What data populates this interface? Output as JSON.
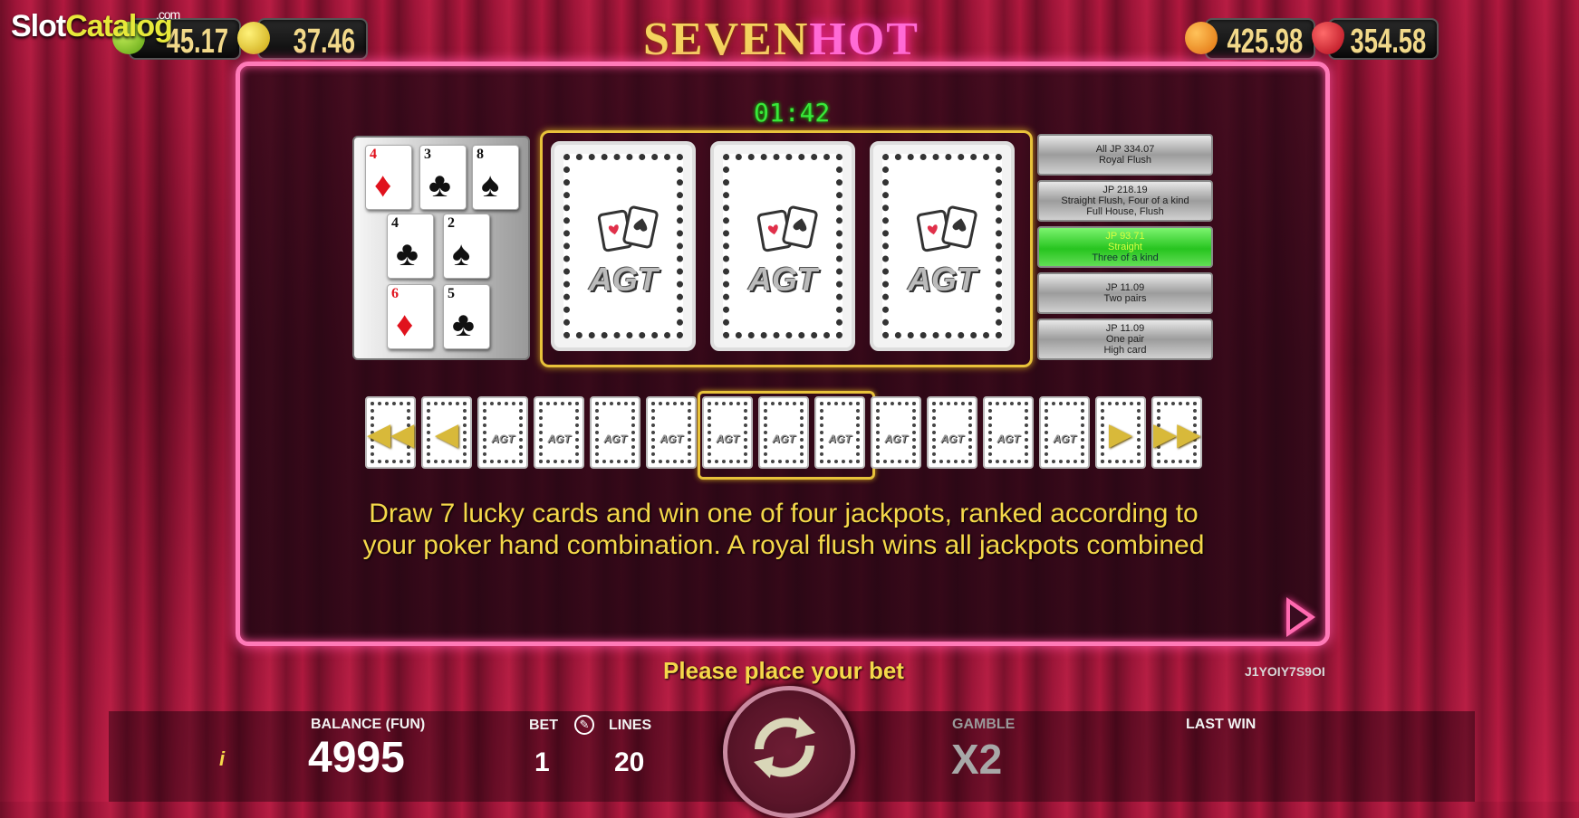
{
  "watermark": {
    "main_a": "Slot",
    "main_b": "Catalog",
    "suffix": ".com"
  },
  "game_title": {
    "part1": "SEVEN",
    "part2": "HOT"
  },
  "jackpot_meters": [
    {
      "fruit": "lime-icon",
      "value": "45.17",
      "color": "#8bd12b"
    },
    {
      "fruit": "lemon-icon",
      "value": "37.46",
      "color": "#e8d22a"
    },
    {
      "fruit": "orange-icon",
      "value": "425.98",
      "color": "#f39a1a"
    },
    {
      "fruit": "strawberry-icon",
      "value": "354.58",
      "color": "#e41c2c"
    }
  ],
  "timer": "01:42",
  "hand_cards": [
    {
      "rank": "4",
      "suit": "♦",
      "color": "red"
    },
    {
      "rank": "3",
      "suit": "♣",
      "color": "blk"
    },
    {
      "rank": "8",
      "suit": "♠",
      "color": "blk"
    },
    {
      "rank": "4",
      "suit": "♣",
      "color": "blk"
    },
    {
      "rank": "2",
      "suit": "♠",
      "color": "blk"
    },
    {
      "rank": "6",
      "suit": "♦",
      "color": "red"
    },
    {
      "rank": "5",
      "suit": "♣",
      "color": "blk"
    }
  ],
  "card_back_label": "AGT",
  "paytable": [
    {
      "line1": "All JP 334.07",
      "line2": "Royal Flush",
      "line3": "",
      "active": false
    },
    {
      "line1": "JP 218.19",
      "line2": "Straight Flush, Four of a kind",
      "line3": "Full House, Flush",
      "active": false
    },
    {
      "line1": "JP 93.71",
      "line2": "Straight",
      "line3": "Three of a kind",
      "active": true
    },
    {
      "line1": "JP 11.09",
      "line2": "Two pairs",
      "line3": "",
      "active": false
    },
    {
      "line1": "JP 11.09",
      "line2": "One pair",
      "line3": "High card",
      "active": false
    }
  ],
  "description": "Draw 7 lucky cards and win one of four jackpots, ranked according to your poker hand combination. A royal flush wins all jackpots combined",
  "status_message": "Please place your bet",
  "session_code": "J1YOIY7S9OI",
  "bottom_bar": {
    "info": "i",
    "balance_label": "BALANCE (FUN)",
    "balance_value": "4995",
    "bet_label": "BET",
    "bet_value": "1",
    "lines_label": "LINES",
    "lines_value": "20",
    "gamble_label": "GAMBLE",
    "gamble_value": "X2",
    "last_win_label": "LAST WIN"
  },
  "colors": {
    "accent_gold": "#f5d84a",
    "panel_border": "#ff7ab8",
    "active_row": "#27c41f",
    "timer": "#39e83a"
  }
}
